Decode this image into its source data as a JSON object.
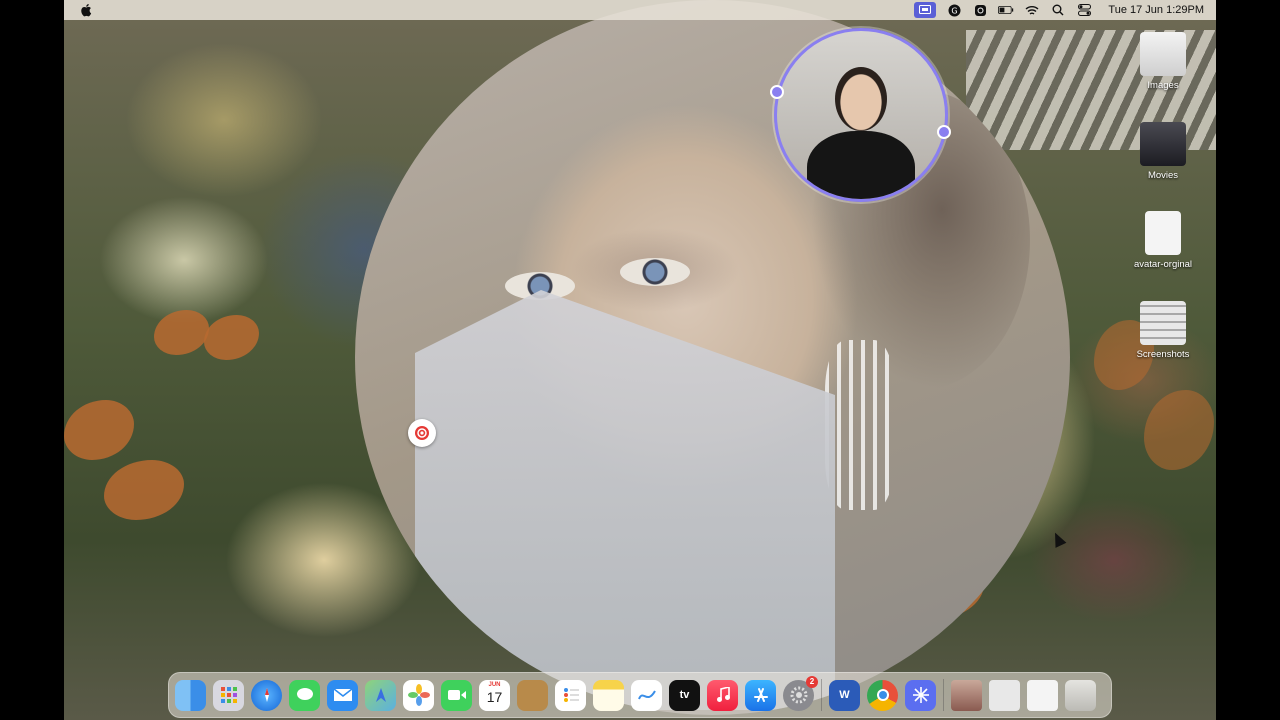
{
  "menubar": {
    "clock": "Tue 17 Jun  1:29PM",
    "icons": [
      "apple-logo",
      "screen-record-icon",
      "grammarly-icon",
      "settings-icon",
      "battery-icon",
      "wifi-icon",
      "search-icon",
      "control-center-icon"
    ]
  },
  "desktop": {
    "icons": [
      {
        "label": "Images"
      },
      {
        "label": "Movies"
      },
      {
        "label": "avatar-orginal"
      },
      {
        "label": "Screenshots"
      }
    ]
  },
  "dock": {
    "apps": [
      {
        "name": "Finder"
      },
      {
        "name": "Launchpad"
      },
      {
        "name": "Safari"
      },
      {
        "name": "Messages"
      },
      {
        "name": "Mail"
      },
      {
        "name": "Maps"
      },
      {
        "name": "Photos"
      },
      {
        "name": "FaceTime"
      },
      {
        "name": "Calendar",
        "month": "JUN",
        "day": "17"
      },
      {
        "name": "Notes-Brown"
      },
      {
        "name": "Reminders"
      },
      {
        "name": "Notes"
      },
      {
        "name": "Freeform"
      },
      {
        "name": "TV",
        "label": "tv"
      },
      {
        "name": "Music"
      },
      {
        "name": "App Store"
      },
      {
        "name": "System Settings",
        "badge": "2"
      },
      {
        "name": "Word",
        "label": "W"
      },
      {
        "name": "Chrome"
      },
      {
        "name": "Spark"
      }
    ]
  },
  "colors": {
    "accent": "#8a7ff0",
    "menubar": "#e6e0d6",
    "record": "#e53935"
  }
}
